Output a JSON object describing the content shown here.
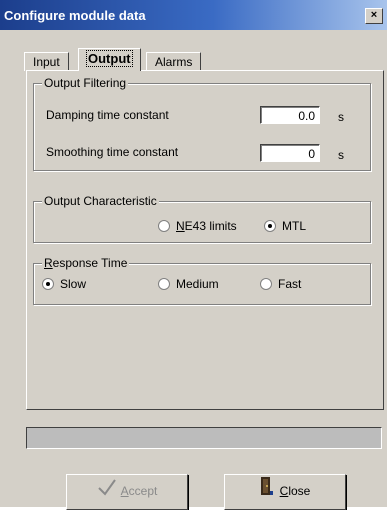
{
  "window": {
    "title": "Configure module data",
    "close_label": "×"
  },
  "tabs": [
    {
      "label": "Input"
    },
    {
      "label": "Output",
      "active": true
    },
    {
      "label": "Alarms"
    }
  ],
  "output_filtering": {
    "title": "Output Filtering",
    "damping": {
      "label": "Damping time constant",
      "value": "0.0",
      "unit": "s"
    },
    "smoothing": {
      "label": "Smoothing time constant",
      "value": "0",
      "unit": "s"
    }
  },
  "output_characteristic": {
    "title": "Output Characteristic",
    "options": [
      {
        "label_u": "N",
        "label_rest": "E43 limits",
        "selected": false
      },
      {
        "label_u": "",
        "label_rest": "MTL",
        "selected": true
      }
    ]
  },
  "response_time": {
    "title_u": "R",
    "title_rest": "esponse Time",
    "options": [
      {
        "label": "Slow",
        "selected": true
      },
      {
        "label": "Medium",
        "selected": false
      },
      {
        "label": "Fast",
        "selected": false
      }
    ]
  },
  "buttons": {
    "accept": {
      "label_u": "A",
      "label_rest": "ccept",
      "icon": "checkmark-icon"
    },
    "close": {
      "label_u": "C",
      "label_rest": "lose",
      "icon": "door-exit-icon"
    }
  },
  "colors": {
    "titlebar_start": "#1c3e8c",
    "titlebar_end": "#a8c4ec",
    "face": "#d4d0c8"
  }
}
